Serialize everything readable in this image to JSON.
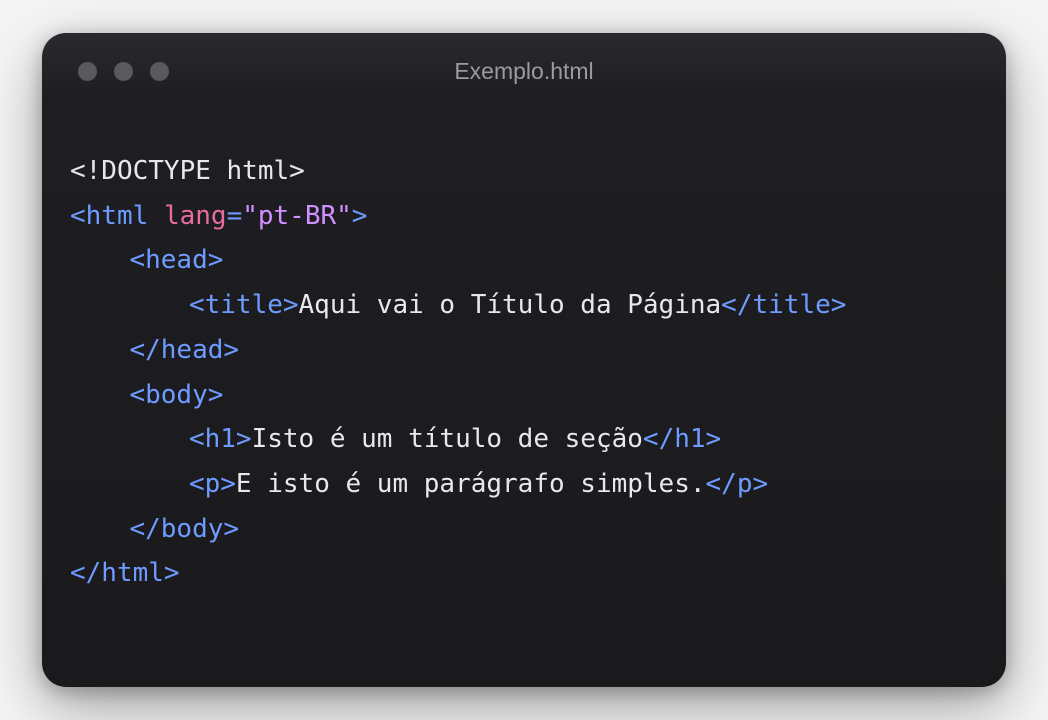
{
  "window": {
    "title": "Exemplo.html"
  },
  "code": {
    "doctype": "<!DOCTYPE html>",
    "html_open_pre": "<",
    "html_tag": "html",
    "html_space": " ",
    "lang_attr": "lang",
    "lang_eq": "=",
    "lang_val": "\"pt-BR\"",
    "html_open_post": ">",
    "head_open": "<head>",
    "title_open": "<title>",
    "title_text": "Aqui vai o Título da Página",
    "title_close": "</title>",
    "head_close": "</head>",
    "body_open": "<body>",
    "h1_open": "<h1>",
    "h1_text": "Isto é um título de seção",
    "h1_close": "</h1>",
    "p_open": "<p>",
    "p_text": "E isto é um parágrafo simples.",
    "p_close": "</p>",
    "body_close": "</body>",
    "html_close": "</html>"
  }
}
